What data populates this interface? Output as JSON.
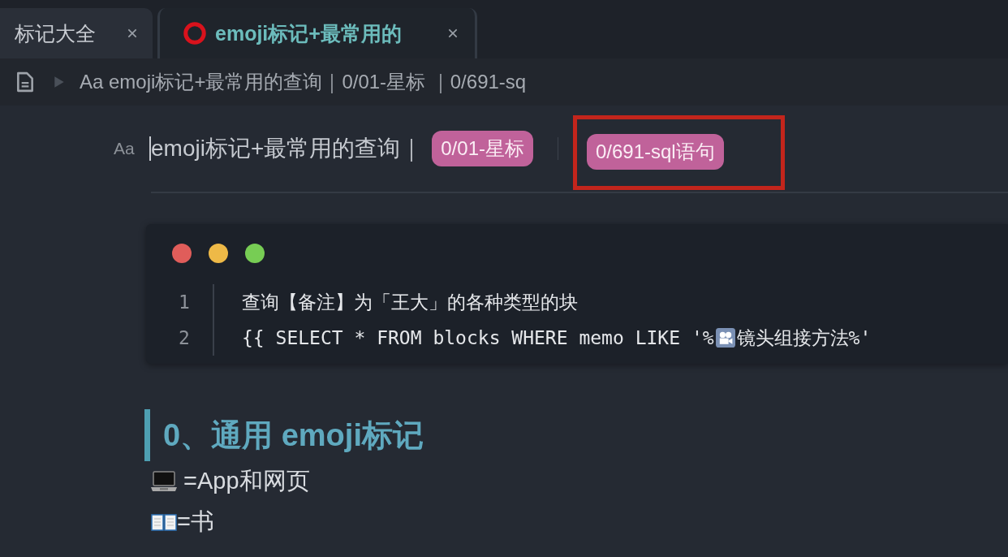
{
  "tabs": [
    {
      "label": "标记大全",
      "selected": false,
      "kind": "plain"
    },
    {
      "label": "emoji标记+最常用的",
      "selected": true,
      "kind": "marked"
    }
  ],
  "breadcrumb": "Aa emoji标记+最常用的查询｜0/01-星标 ｜0/691-sq",
  "doc": {
    "title_icon": "Aa",
    "title": "emoji标记+最常用的查询｜",
    "tags": [
      {
        "label": "0/01-星标",
        "highlighted": false
      },
      {
        "label": "0/691-sql语句",
        "highlighted": true
      }
    ]
  },
  "code_block": {
    "lines": [
      {
        "number": "1",
        "text": "查询【备注】为「王大」的各种类型的块"
      },
      {
        "number": "2",
        "text": "{{ SELECT * FROM blocks WHERE memo LIKE '%",
        "kind": "split",
        "text_after": "镜头组接方法%'"
      }
    ]
  },
  "heading": "0、通用 emoji标记",
  "items": [
    {
      "kind": "laptop",
      "text": " =App和网页"
    },
    {
      "kind": "book",
      "text": "=书"
    }
  ]
}
